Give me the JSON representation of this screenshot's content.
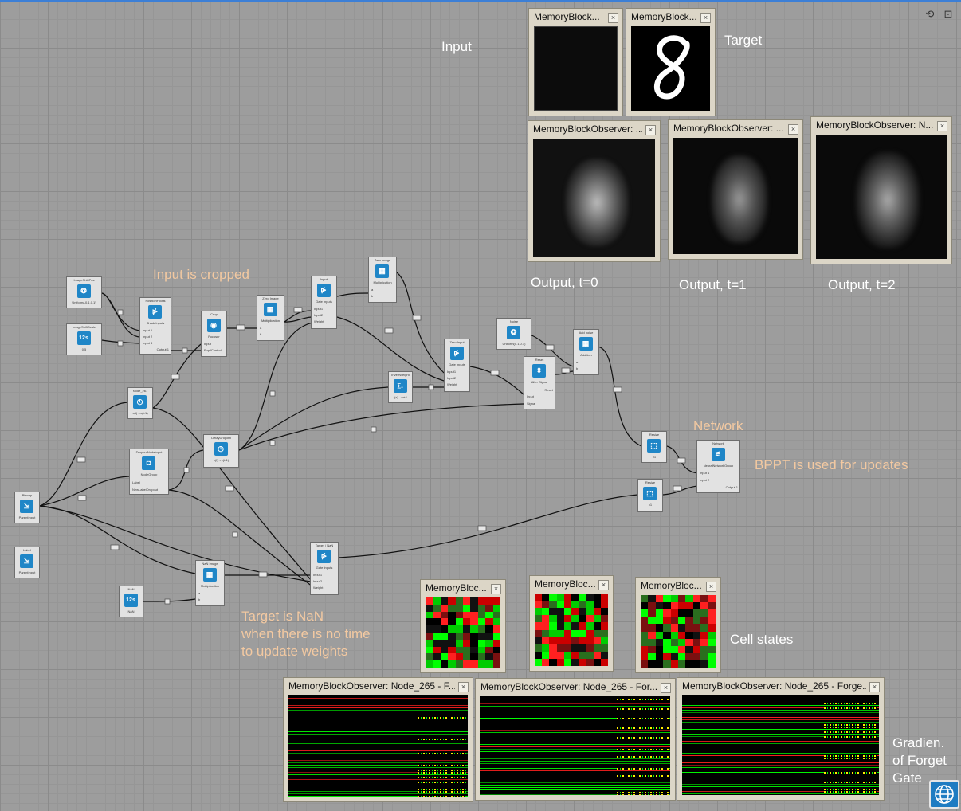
{
  "nodes": {
    "image_shift_pos": {
      "title": "ImageShiftPos",
      "sub": "Uniform(-0.1,0.1)",
      "icon": "❂"
    },
    "image_shift_scale": {
      "title": "ImageShiftScale",
      "sub": "0.5",
      "icon": "12s"
    },
    "position_focus": {
      "title": "PositionFocus",
      "sub": "ShadeInputs",
      "ports": [
        "Input 1",
        "Input 2",
        "Input 3"
      ],
      "out": "Output 1",
      "icon": "⋫"
    },
    "crop": {
      "title": "Crop",
      "sub": "Focuser",
      "ports": [
        "Input",
        "PupilControl"
      ],
      "icon": "◉"
    },
    "zero_image_a": {
      "title": "Zero Image",
      "sub": "Multiplication",
      "ports": [
        "a",
        "b"
      ],
      "icon": "▦"
    },
    "input_gate": {
      "title": "Input",
      "sub": "Gate Inputs",
      "ports": [
        "Input1",
        "Input2",
        "Weight"
      ],
      "icon": "⋫"
    },
    "zero_image_b": {
      "title": "Zero Image",
      "sub": "Multiplication",
      "ports": [
        "a",
        "b"
      ],
      "icon": "▦"
    },
    "node_261": {
      "title": "Node_261",
      "sub": "x(t)→x(t-1)",
      "icon": "◷"
    },
    "invert_weight": {
      "title": "InvertWeight",
      "sub": "f(x)→w+1",
      "icon": "∑ₓ"
    },
    "zero_input": {
      "title": "Zero Input",
      "sub": "Gate Inputs",
      "ports": [
        "Input1",
        "Input2",
        "Weight"
      ],
      "icon": "⋫"
    },
    "noise": {
      "title": "Noise",
      "sub": "Uniform(0.1,0.1)",
      "icon": "❂"
    },
    "reset": {
      "title": "Reset",
      "sub": "Alter Signal",
      "ports": [
        "Input",
        "Signal"
      ],
      "out": "Reset",
      "icon": "⇕"
    },
    "add_noise": {
      "title": "Add noise",
      "sub": "Addition",
      "ports": [
        "a",
        "b"
      ],
      "icon": "▦"
    },
    "dropout_node_input": {
      "title": "DropoutNodeInput",
      "sub": "NodeGroup",
      "ports": [
        "Label"
      ],
      "out": "NewLabelDropout",
      "icon": "◘"
    },
    "delay_dropout": {
      "title": "DelayDropout",
      "sub": "x(t)→x(t-1)",
      "icon": "◷"
    },
    "bitmap": {
      "title": "Bitmap",
      "sub": "ParentInput",
      "icon": "⇲"
    },
    "label": {
      "title": "Label",
      "sub": "ParentInput",
      "icon": "⇲"
    },
    "resize_a": {
      "title": "Resize",
      "sub": "x1",
      "icon": "⬚"
    },
    "resize_b": {
      "title": "Resize",
      "sub": "x1",
      "icon": "⬚"
    },
    "network": {
      "title": "Network",
      "sub": "NeuralNetworkGroup",
      "ports": [
        "Input 1",
        "Input 2"
      ],
      "out": "Output 1",
      "icon": "⚟"
    },
    "target_nan": {
      "title": "Target / NaN",
      "sub": "Gate Inputs",
      "ports": [
        "Input1",
        "Input2",
        "Weight"
      ],
      "icon": "⋫"
    },
    "nan_image": {
      "title": "NaN Image",
      "sub": "Multiplication",
      "ports": [
        "a",
        "b"
      ],
      "icon": "▦"
    },
    "nan": {
      "title": "NaN",
      "sub": "NaN",
      "icon": "12s"
    }
  },
  "annotations": {
    "input": "Input",
    "target": "Target",
    "output_t0": "Output, t=0",
    "output_t1": "Output, t=1",
    "output_t2": "Output, t=2",
    "input_cropped": "Input is cropped",
    "network": "Network",
    "bptt": "BPPT is used for updates",
    "target_nan_line1": "Target is NaN",
    "target_nan_line2": "when there is no time",
    "target_nan_line3": "to update weights",
    "cell_states": "Cell states",
    "gradient_line1": "Gradien.",
    "gradient_line2": "of Forget",
    "gradient_line3": "Gate"
  },
  "observers": {
    "input_obs": "MemoryBlock...",
    "target_obs": "MemoryBlock...",
    "out0": "MemoryBlockObserver: ...",
    "out1": "MemoryBlockObserver: ...",
    "out2": "MemoryBlockObserver: N...",
    "cell1": "MemoryBloc...",
    "cell2": "MemoryBloc...",
    "cell3": "MemoryBloc...",
    "grad1": "MemoryBlockObserver: Node_265 - F...",
    "grad2": "MemoryBlockObserver: Node_265 - For...",
    "grad3": "MemoryBlockObserver: Node_265 - Forge..."
  },
  "wire_labels": {
    "multi": "*K",
    "one": "1"
  },
  "toolbar": {
    "reset_icon": "undo-icon",
    "fit_icon": "fit-view-icon"
  },
  "colors": {
    "accent": "#1f86c7",
    "note": "#f3c9a1",
    "positive": "#00ff00",
    "negative": "#ff2020"
  }
}
